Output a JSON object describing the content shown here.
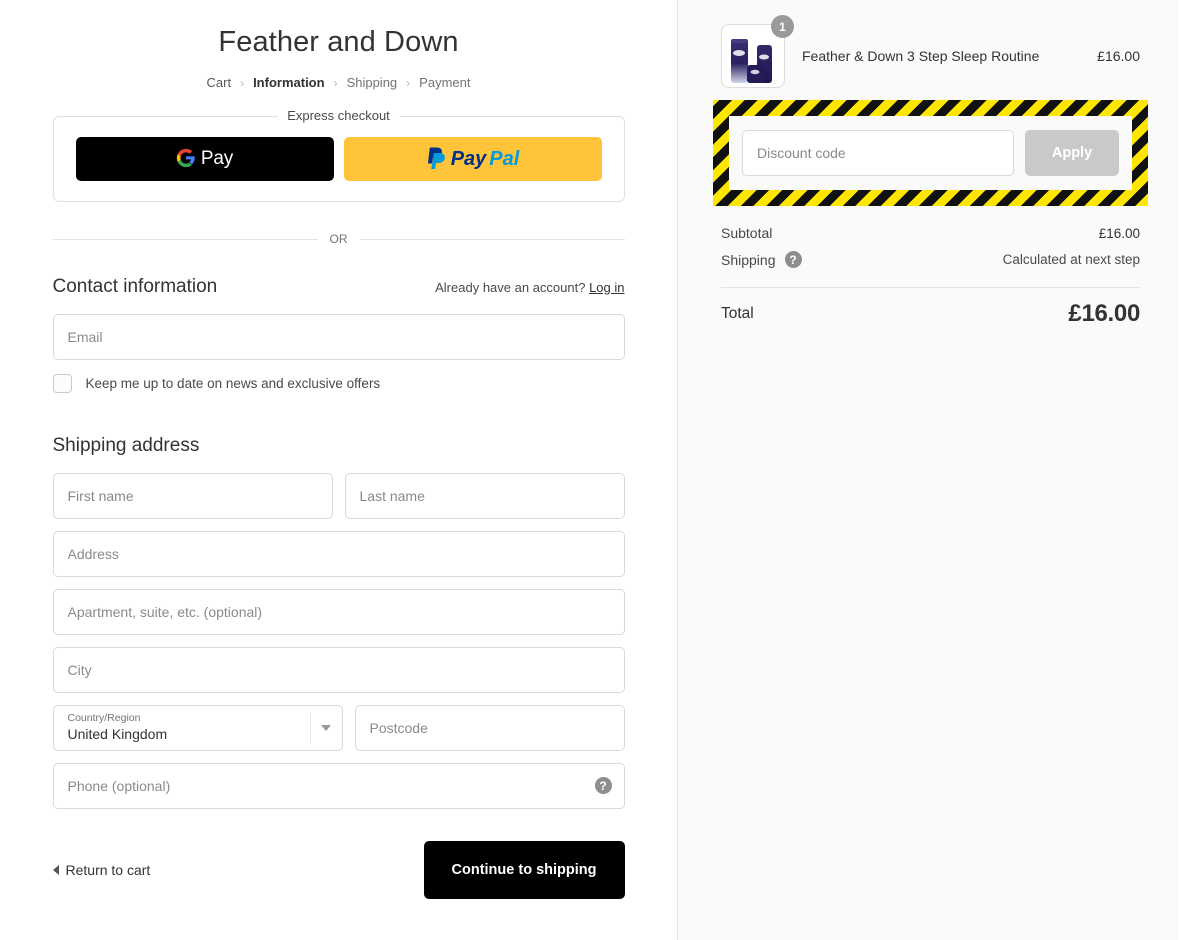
{
  "shop": {
    "title": "Feather and Down"
  },
  "breadcrumb": {
    "items": [
      {
        "label": "Cart",
        "state": "done"
      },
      {
        "label": "Information",
        "state": "current"
      },
      {
        "label": "Shipping",
        "state": "upcoming"
      },
      {
        "label": "Payment",
        "state": "upcoming"
      }
    ],
    "separator": "›"
  },
  "express": {
    "legend": "Express checkout",
    "gpay_label": "Pay",
    "paypal_pay": "Pay",
    "paypal_pal": "Pal"
  },
  "divider": {
    "or": "OR"
  },
  "contact": {
    "title": "Contact information",
    "login_prompt": "Already have an account?",
    "login_link": "Log in",
    "email_placeholder": "Email",
    "email_value": "",
    "newsletter_label": "Keep me up to date on news and exclusive offers",
    "newsletter_checked": false
  },
  "shipping_address": {
    "title": "Shipping address",
    "first_name_placeholder": "First name",
    "first_name_value": "",
    "last_name_placeholder": "Last name",
    "last_name_value": "",
    "address_placeholder": "Address",
    "address_value": "",
    "apartment_placeholder": "Apartment, suite, etc. (optional)",
    "apartment_value": "",
    "city_placeholder": "City",
    "city_value": "",
    "country_label": "Country/Region",
    "country_value": "United Kingdom",
    "postcode_placeholder": "Postcode",
    "postcode_value": "",
    "phone_placeholder": "Phone (optional)",
    "phone_value": ""
  },
  "form_footer": {
    "return_label": "Return to cart",
    "continue_label": "Continue to shipping"
  },
  "summary": {
    "product": {
      "name": "Feather & Down 3 Step Sleep Routine",
      "price": "£16.00",
      "quantity": "1"
    },
    "discount": {
      "placeholder": "Discount code",
      "value": "",
      "apply_label": "Apply"
    },
    "lines": [
      {
        "label": "Subtotal",
        "value": "£16.00",
        "has_help": false
      },
      {
        "label": "Shipping",
        "value": "Calculated at next step",
        "has_help": true
      }
    ],
    "total_label": "Total",
    "total_value": "£16.00"
  },
  "colors": {
    "paypal_yellow": "#ffc439",
    "paypal_navy": "#003087",
    "paypal_blue": "#009cde",
    "hazard_yellow": "#ffe600",
    "hazard_black": "#111111",
    "apply_disabled": "#c9c9c9",
    "primary_button": "#000000"
  }
}
